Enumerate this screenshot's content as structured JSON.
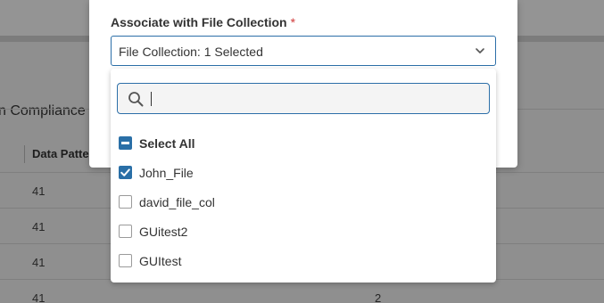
{
  "background": {
    "heading": "n Compliance F",
    "column_header": "Data Patte",
    "rows": [
      {
        "col1": "41",
        "col2": ""
      },
      {
        "col1": "41",
        "col2": ""
      },
      {
        "col1": "41",
        "col2": ""
      },
      {
        "col1": "41",
        "col2": "2"
      }
    ]
  },
  "modal": {
    "field_label": "Associate with File Collection",
    "required_marker": "*",
    "select_value": "File Collection: 1 Selected"
  },
  "dropdown": {
    "search_value": "",
    "options": [
      {
        "label": "Select All",
        "state": "indeterminate"
      },
      {
        "label": "John_File",
        "state": "checked"
      },
      {
        "label": "david_file_col",
        "state": "unchecked"
      },
      {
        "label": "GUitest2",
        "state": "unchecked"
      },
      {
        "label": "GUItest",
        "state": "unchecked"
      }
    ]
  },
  "colors": {
    "accent": "#2a6fa7",
    "required": "#d13a3a"
  },
  "icons": [
    "chevron-down-icon",
    "search-icon",
    "checkmark-icon",
    "minus-icon"
  ]
}
